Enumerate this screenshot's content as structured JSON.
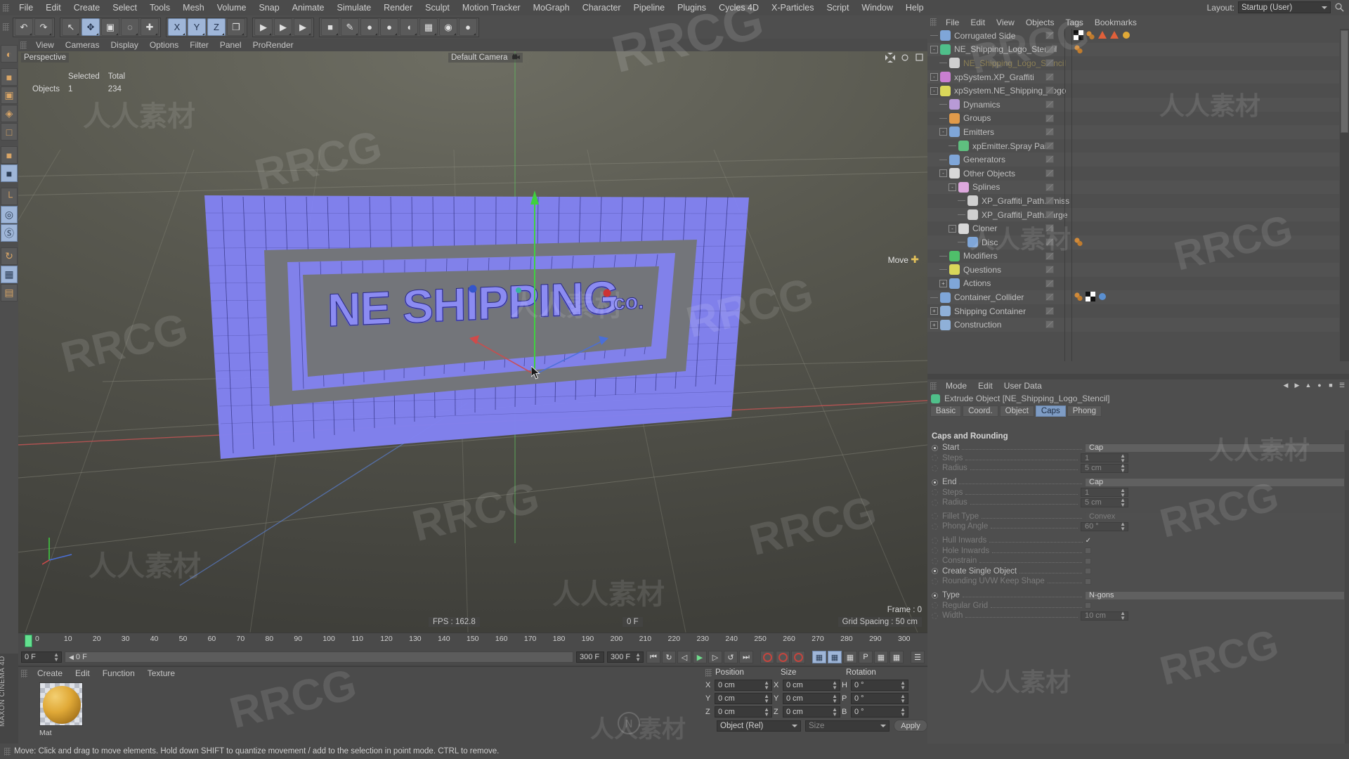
{
  "app": {
    "title": "CINEMA 4D",
    "brand_vertical": "MAXON CINEMA 4D"
  },
  "top_menu": {
    "items": [
      "File",
      "Edit",
      "Create",
      "Select",
      "Tools",
      "Mesh",
      "Volume",
      "Snap",
      "Animate",
      "Simulate",
      "Render",
      "Sculpt",
      "Motion Tracker",
      "MoGraph",
      "Character",
      "Pipeline",
      "Plugins",
      "Cycles 4D",
      "X-Particles",
      "Script",
      "Window",
      "Help"
    ],
    "layout_label": "Layout:",
    "layout_value": "Startup (User)",
    "search_icon": "magnifier-icon"
  },
  "toolbar": {
    "groups": [
      {
        "name": "history",
        "buttons": [
          {
            "icon": "undo-icon",
            "glyph": "↶",
            "selected": false
          },
          {
            "icon": "redo-icon",
            "glyph": "↷",
            "selected": false
          }
        ]
      },
      {
        "name": "transform-tools",
        "buttons": [
          {
            "icon": "live-selection-icon",
            "glyph": "↖",
            "selected": false
          },
          {
            "icon": "move-tool-icon",
            "glyph": "✥",
            "selected": true
          },
          {
            "icon": "scale-tool-icon",
            "glyph": "▣",
            "selected": false
          },
          {
            "icon": "rotate-tool-icon",
            "glyph": "◌",
            "selected": false
          },
          {
            "icon": "axis-tool-icon",
            "glyph": "✚",
            "selected": false
          }
        ]
      },
      {
        "name": "axis-locks",
        "buttons": [
          {
            "icon": "x-axis-icon",
            "glyph": "X",
            "selected": true
          },
          {
            "icon": "y-axis-icon",
            "glyph": "Y",
            "selected": true
          },
          {
            "icon": "z-axis-icon",
            "glyph": "Z",
            "selected": true
          },
          {
            "icon": "world-coordinate-icon",
            "glyph": "❐",
            "selected": false
          }
        ]
      },
      {
        "name": "render-tools",
        "buttons": [
          {
            "icon": "render-view-icon",
            "glyph": "▶",
            "selected": false
          },
          {
            "icon": "render-region-icon",
            "glyph": "▶",
            "selected": false
          },
          {
            "icon": "render-settings-icon",
            "glyph": "▶",
            "selected": false
          }
        ]
      },
      {
        "name": "object-creation",
        "buttons": [
          {
            "icon": "cube-primitive-icon",
            "glyph": "■",
            "selected": false
          },
          {
            "icon": "spline-pen-icon",
            "glyph": "✎",
            "selected": false
          },
          {
            "icon": "generator-icon",
            "glyph": "●",
            "selected": false
          },
          {
            "icon": "array-icon",
            "glyph": "●",
            "selected": false
          },
          {
            "icon": "deformer-icon",
            "glyph": "◖",
            "selected": false
          },
          {
            "icon": "environment-icon",
            "glyph": "▦",
            "selected": false
          },
          {
            "icon": "camera-icon",
            "glyph": "◉",
            "selected": false
          },
          {
            "icon": "light-icon",
            "glyph": "●",
            "selected": false
          }
        ]
      }
    ]
  },
  "left_toolbar": {
    "buttons": [
      {
        "icon": "texture-axis-icon",
        "selected": false
      },
      {
        "icon": "model-mode-icon",
        "selected": false
      },
      {
        "icon": "texture-mode-icon",
        "selected": false
      },
      {
        "icon": "points-mode-icon",
        "selected": false
      },
      {
        "icon": "edges-mode-icon",
        "selected": false
      },
      {
        "icon": "polygons-mode-icon",
        "selected": false
      },
      {
        "icon": "object-axis-icon",
        "selected": true
      },
      {
        "icon": "workplane-icon",
        "selected": false
      },
      {
        "icon": "viewport-solo-icon",
        "selected": true
      },
      {
        "icon": "snap-enable-icon",
        "selected": true
      },
      {
        "icon": "magnet-icon",
        "selected": false
      },
      {
        "icon": "quantize-icon",
        "selected": true
      },
      {
        "icon": "lock-axis-icon",
        "selected": false
      }
    ]
  },
  "viewport": {
    "menu": [
      "View",
      "Cameras",
      "Display",
      "Options",
      "Filter",
      "Panel",
      "ProRender"
    ],
    "perspective_label": "Perspective",
    "camera_label": "Default Camera",
    "camera_icon": "camera-icon",
    "info": {
      "col_selected": "Selected",
      "col_total": "Total",
      "row_label": "Objects",
      "selected": "1",
      "total": "234"
    },
    "move_tag": "Move",
    "move_tag_icon": "move-axis-icon",
    "fps": "FPS : 162.8",
    "current_frame": "0 F",
    "grid_spacing": "Grid Spacing : 50 cm",
    "frame_readout": "Frame : 0",
    "scene_object": "NE_SHIPPING_CO. corrugated stencil wall"
  },
  "timeline": {
    "ticks": [
      "0",
      "10",
      "20",
      "30",
      "40",
      "50",
      "60",
      "70",
      "80",
      "90",
      "100",
      "110",
      "120",
      "130",
      "140",
      "150",
      "160",
      "170",
      "180",
      "190",
      "200",
      "210",
      "220",
      "230",
      "240",
      "250",
      "260",
      "270",
      "280",
      "290",
      "300"
    ],
    "current_frame_field": "0 F",
    "end_frame_field": "300 F",
    "preview_start": "0 F",
    "preview_end": "300 F",
    "playhead_frame": "0",
    "playback_buttons": [
      {
        "icon": "go-to-start-icon",
        "glyph": "⏮"
      },
      {
        "icon": "previous-key-icon",
        "glyph": "↻"
      },
      {
        "icon": "step-back-icon",
        "glyph": "◁"
      },
      {
        "icon": "play-icon",
        "glyph": "▶"
      },
      {
        "icon": "step-forward-icon",
        "glyph": "▷"
      },
      {
        "icon": "next-key-icon",
        "glyph": "↺"
      },
      {
        "icon": "go-to-end-icon",
        "glyph": "⏭"
      }
    ],
    "record_buttons": [
      {
        "icon": "record-active-objects-icon",
        "color": "#c4453e"
      },
      {
        "icon": "autokeying-icon",
        "color": "#c4453e"
      },
      {
        "icon": "keyframe-selection-icon",
        "color": "#c4453e"
      }
    ],
    "param_buttons": [
      {
        "icon": "record-position-icon",
        "selected": true
      },
      {
        "icon": "record-scale-icon",
        "selected": true
      },
      {
        "icon": "record-rotation-icon",
        "selected": false
      },
      {
        "icon": "record-pla-icon",
        "selected": false,
        "glyph": "P"
      },
      {
        "icon": "record-points-icon",
        "selected": false
      },
      {
        "icon": "keyframe-tracks-icon",
        "selected": false
      }
    ]
  },
  "material_manager": {
    "menu": [
      "Create",
      "Edit",
      "Function",
      "Texture"
    ],
    "material_name": "Mat",
    "material_color": "#e0a937"
  },
  "coordinates": {
    "headers": [
      "Position",
      "Size",
      "Rotation"
    ],
    "rows": [
      {
        "pos_axis": "X",
        "pos_value": "0 cm",
        "size_axis": "X",
        "size_value": "0 cm",
        "rot_axis": "H",
        "rot_value": "0 °"
      },
      {
        "pos_axis": "Y",
        "pos_value": "0 cm",
        "size_axis": "Y",
        "size_value": "0 cm",
        "rot_axis": "P",
        "rot_value": "0 °"
      },
      {
        "pos_axis": "Z",
        "pos_value": "0 cm",
        "size_axis": "Z",
        "size_value": "0 cm",
        "rot_axis": "B",
        "rot_value": "0 °"
      }
    ],
    "mode_value": "Object (Rel)",
    "size_mode_value": "Size",
    "apply_label": "Apply"
  },
  "status_bar": {
    "message": "Move: Click and drag to move elements. Hold down SHIFT to quantize movement / add to the selection in point mode. CTRL to remove."
  },
  "object_manager": {
    "menu": [
      "File",
      "Edit",
      "View",
      "Objects",
      "Tags",
      "Bookmarks"
    ],
    "rows": [
      {
        "label": "Corrugated Side",
        "depth": 0,
        "icon": "polygon-object-icon",
        "icon_color": "#7fa6d8",
        "expander": "",
        "dim": false,
        "vis_top": "#5d5d5d",
        "vis_bottom": "#c4453e",
        "tags": [
          "checker-texture-tag",
          "xpresso-tag",
          "deformer-tag",
          "deformer-tag",
          "material-tag"
        ]
      },
      {
        "label": "NE_Shipping_Logo_Stencil",
        "depth": 0,
        "icon": "extrude-object-icon",
        "icon_color": "#4fbf8a",
        "expander": "-",
        "dim": false,
        "vis_top": "#5d5d5d",
        "vis_bottom": "#5bbf7d",
        "tags": [
          "xpresso-tag"
        ]
      },
      {
        "label": "NE_Shipping_Logo_Stencil",
        "depth": 1,
        "icon": "spline-object-icon",
        "icon_color": "#cfcfcf",
        "expander": "",
        "dim": true,
        "vis_top": "#5d5d5d",
        "vis_bottom": "#5bbf7d",
        "tags": []
      },
      {
        "label": "xpSystem.XP_Graffiti",
        "depth": 0,
        "icon": "xparticles-system-icon",
        "icon_color": "#c97fd1",
        "expander": "-",
        "dim": false,
        "vis_top": "#5d5d5d",
        "vis_bottom": "#c4453e",
        "tags": []
      },
      {
        "label": "xpSystem.NE_Shipping_Logo",
        "depth": 0,
        "icon": "xparticles-system-icon",
        "icon_color": "#d9d75a",
        "expander": "-",
        "dim": false,
        "vis_top": "#5d5d5d",
        "vis_bottom": "#5bbf7d",
        "tags": []
      },
      {
        "label": "Dynamics",
        "depth": 1,
        "icon": "folder-group-icon",
        "icon_color": "#b89ad6",
        "expander": "",
        "dim": false,
        "vis_top": "#5d5d5d",
        "vis_bottom": "#5bbf7d",
        "tags": []
      },
      {
        "label": "Groups",
        "depth": 1,
        "icon": "folder-group-icon",
        "icon_color": "#e09a4a",
        "expander": "",
        "dim": false,
        "vis_top": "#5d5d5d",
        "vis_bottom": "#5bbf7d",
        "tags": []
      },
      {
        "label": "Emitters",
        "depth": 1,
        "icon": "folder-group-icon",
        "icon_color": "#7fa6d8",
        "expander": "-",
        "dim": false,
        "vis_top": "#5d5d5d",
        "vis_bottom": "#5bbf7d",
        "tags": []
      },
      {
        "label": "xpEmitter.Spray Paint",
        "depth": 2,
        "icon": "xparticles-emitter-icon",
        "icon_color": "#5fbf7f",
        "expander": "",
        "dim": false,
        "vis_top": "#5d5d5d",
        "vis_bottom": "#5bbf7d",
        "tags": []
      },
      {
        "label": "Generators",
        "depth": 1,
        "icon": "folder-group-icon",
        "icon_color": "#7fa6d8",
        "expander": "",
        "dim": false,
        "vis_top": "#5d5d5d",
        "vis_bottom": "#5bbf7d",
        "tags": []
      },
      {
        "label": "Other Objects",
        "depth": 1,
        "icon": "folder-group-icon",
        "icon_color": "#d8d8d8",
        "expander": "-",
        "dim": false,
        "vis_top": "#5d5d5d",
        "vis_bottom": "#5bbf7d",
        "tags": []
      },
      {
        "label": "Splines",
        "depth": 2,
        "icon": "folder-icon",
        "icon_color": "#dda8dd",
        "expander": "-",
        "dim": false,
        "vis_top": "#c4453e",
        "vis_bottom": "#5bbf7d",
        "tags": []
      },
      {
        "label": "XP_Graffiti_Path.Emiss",
        "depth": 3,
        "icon": "spline-object-icon",
        "icon_color": "#cfcfcf",
        "expander": "",
        "dim": false,
        "vis_top": "#5d5d5d",
        "vis_bottom": "#5bbf7d",
        "tags": []
      },
      {
        "label": "XP_Graffiti_Path.Targe",
        "depth": 3,
        "icon": "spline-object-icon",
        "icon_color": "#cfcfcf",
        "expander": "",
        "dim": false,
        "vis_top": "#5d5d5d",
        "vis_bottom": "#5bbf7d",
        "tags": []
      },
      {
        "label": "Cloner",
        "depth": 2,
        "icon": "mograph-cloner-icon",
        "icon_color": "#d8d8d8",
        "expander": "-",
        "dim": false,
        "vis_top": "#5d5d5d",
        "vis_bottom": "#5bbf7d",
        "tags": []
      },
      {
        "label": "Disc",
        "depth": 3,
        "icon": "disc-primitive-icon",
        "icon_color": "#7fa6d8",
        "expander": "",
        "dim": false,
        "vis_top": "#5d5d5d",
        "vis_bottom": "#5bbf7d",
        "tags": [
          "xpresso-tag"
        ]
      },
      {
        "label": "Modifiers",
        "depth": 1,
        "icon": "folder-group-icon",
        "icon_color": "#4fbf6a",
        "expander": "",
        "dim": false,
        "vis_top": "#5d5d5d",
        "vis_bottom": "#5bbf7d",
        "tags": []
      },
      {
        "label": "Questions",
        "depth": 1,
        "icon": "folder-group-icon",
        "icon_color": "#d9d75a",
        "expander": "",
        "dim": false,
        "vis_top": "#5d5d5d",
        "vis_bottom": "#5bbf7d",
        "tags": []
      },
      {
        "label": "Actions",
        "depth": 1,
        "icon": "folder-group-icon",
        "icon_color": "#7fa6d8",
        "expander": "+",
        "dim": false,
        "vis_top": "#5d5d5d",
        "vis_bottom": "#5bbf7d",
        "tags": []
      },
      {
        "label": "Container_Collider",
        "depth": 0,
        "icon": "polygon-object-icon",
        "icon_color": "#7fa6d8",
        "expander": "",
        "dim": false,
        "vis_top": "#5d5d5d",
        "vis_bottom": "#5d5d5d",
        "tags": [
          "xpresso-tag",
          "checker-texture-tag",
          "dynamics-tag"
        ]
      },
      {
        "label": "Shipping Container",
        "depth": 0,
        "icon": "null-object-icon",
        "icon_color": "#8fb0d8",
        "expander": "+",
        "dim": false,
        "vis_top": "#5d5d5d",
        "vis_bottom": "#c4453e",
        "tags": []
      },
      {
        "label": "Construction",
        "depth": 0,
        "icon": "null-object-icon",
        "icon_color": "#8fb0d8",
        "expander": "+",
        "dim": false,
        "vis_top": "#5d5d5d",
        "vis_bottom": "#c4453e",
        "tags": []
      }
    ]
  },
  "attribute_manager": {
    "menu": [
      "Mode",
      "Edit",
      "User Data"
    ],
    "title": "Extrude Object [NE_Shipping_Logo_Stencil]",
    "title_icon": "extrude-object-icon",
    "tabs": [
      {
        "label": "Basic",
        "selected": false
      },
      {
        "label": "Coord.",
        "selected": false
      },
      {
        "label": "Object",
        "selected": false
      },
      {
        "label": "Caps",
        "selected": true
      },
      {
        "label": "Phong",
        "selected": false
      }
    ],
    "section_title": "Caps and Rounding",
    "params": [
      {
        "label": "Start",
        "type": "combo",
        "value": "Cap",
        "radio": "on",
        "disabled": false
      },
      {
        "label": "Steps",
        "type": "number",
        "value": "1",
        "radio": "off",
        "disabled": true
      },
      {
        "label": "Radius",
        "type": "number",
        "value": "5 cm",
        "radio": "off",
        "disabled": true
      },
      {
        "label": "End",
        "type": "combo",
        "value": "Cap",
        "radio": "on",
        "disabled": false
      },
      {
        "label": "Steps",
        "type": "number",
        "value": "1",
        "radio": "off",
        "disabled": true
      },
      {
        "label": "Radius",
        "type": "number",
        "value": "5 cm",
        "radio": "off",
        "disabled": true
      },
      {
        "label": "Fillet Type",
        "type": "combo",
        "value": "Convex",
        "radio": "off",
        "disabled": true
      },
      {
        "label": "Phong Angle",
        "type": "number",
        "value": "60 °",
        "radio": "off",
        "disabled": true
      },
      {
        "label": "Hull Inwards",
        "type": "check",
        "value": true,
        "radio": "off",
        "disabled": true
      },
      {
        "label": "Hole Inwards",
        "type": "check",
        "value": false,
        "radio": "off",
        "disabled": true
      },
      {
        "label": "Constrain",
        "type": "check",
        "value": false,
        "radio": "off",
        "disabled": true
      },
      {
        "label": "Create Single Object",
        "type": "check",
        "value": false,
        "radio": "on",
        "disabled": false
      },
      {
        "label": "Rounding UVW Keep Shape",
        "type": "check",
        "value": false,
        "radio": "off",
        "disabled": true
      },
      {
        "label": "Type",
        "type": "combo",
        "value": "N-gons",
        "radio": "on",
        "disabled": false
      },
      {
        "label": "Regular Grid",
        "type": "check",
        "value": false,
        "radio": "off",
        "disabled": true
      },
      {
        "label": "Width",
        "type": "number",
        "value": "10 cm",
        "radio": "off",
        "disabled": true
      }
    ]
  },
  "watermarks": {
    "latin": "RRCG",
    "chinese": "人人素材",
    "logo_text": "人人素材"
  }
}
